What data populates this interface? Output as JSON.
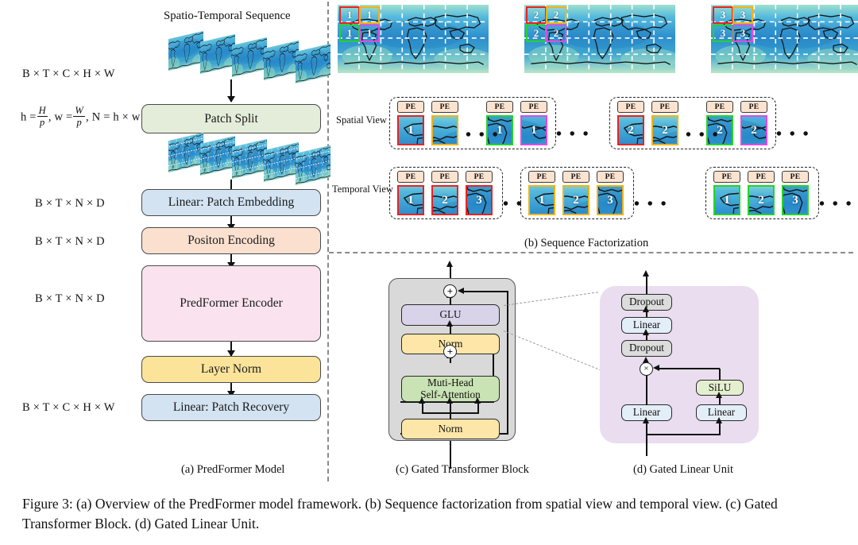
{
  "figure": {
    "caption": "Figure 3: (a) Overview of the PredFormer model framework. (b) Sequence factorization from spatial view and temporal view. (c) Gated Transformer Block. (d) Gated Linear Unit."
  },
  "panel_a": {
    "caption": "(a) PredFormer Model",
    "sequence_title": "Spatio-Temporal Sequence",
    "shapes": [
      "B × T × C × H × W",
      "B × T × N × D",
      "B × T × N × D",
      "B × T × N × D",
      "B × T × C × H × W"
    ],
    "patch_formula": {
      "prefix_h": "h =",
      "h_num": "H",
      "h_den": "p",
      "mid_w": ", w =",
      "w_num": "W",
      "w_den": "p",
      "suffix": ", N = h × w"
    },
    "blocks": [
      {
        "label": "Patch Split",
        "color": "#e4edd9"
      },
      {
        "label": "Linear: Patch Embedding",
        "color": "#d3e3f2"
      },
      {
        "label": "Positon Encoding",
        "color": "#fbe0d0"
      },
      {
        "label": "PredFormer Encoder",
        "color": "#fae3ee"
      },
      {
        "label": "Layer Norm",
        "color": "#fbe49a"
      },
      {
        "label": "Linear: Patch Recovery",
        "color": "#d3e3f2"
      }
    ]
  },
  "panel_b": {
    "caption": "(b) Sequence Factorization",
    "view_labels": {
      "spatial": "Spatial View",
      "temporal": "Temporal View"
    },
    "pe_label": "PE",
    "ellipsis": "• • •",
    "patch_colors": {
      "red": "#ef2020",
      "orange": "#f5b115",
      "green": "#25d32b",
      "magenta": "#e24ae2"
    },
    "frames": [
      {
        "index": "1",
        "patch_labels": [
          "1",
          "1",
          "1",
          "1"
        ]
      },
      {
        "index": "2",
        "patch_labels": [
          "2",
          "2",
          "2",
          "2"
        ]
      },
      {
        "index": "3",
        "patch_labels": [
          "3",
          "3",
          "3",
          "3"
        ]
      }
    ],
    "spatial_groups": [
      {
        "tokens": [
          {
            "label": "1",
            "border": "red"
          },
          {
            "label": "",
            "border": "orange"
          },
          {
            "label": "1",
            "border": "green"
          },
          {
            "label": "1",
            "border": "magenta"
          }
        ]
      },
      {
        "tokens": [
          {
            "label": "2",
            "border": "red"
          },
          {
            "label": "2",
            "border": "orange"
          },
          {
            "label": "2",
            "border": "green"
          },
          {
            "label": "2",
            "border": "magenta"
          }
        ]
      }
    ],
    "temporal_groups": [
      {
        "tokens": [
          {
            "label": "1",
            "border": "red"
          },
          {
            "label": "2",
            "border": "red"
          },
          {
            "label": "3",
            "border": "red"
          }
        ]
      },
      {
        "tokens": [
          {
            "label": "1",
            "border": "orange"
          },
          {
            "label": "2",
            "border": "orange"
          },
          {
            "label": "3",
            "border": "orange"
          }
        ]
      },
      {
        "tokens": [
          {
            "label": "1",
            "border": "green"
          },
          {
            "label": "2",
            "border": "green"
          },
          {
            "label": "3",
            "border": "green"
          }
        ]
      }
    ]
  },
  "panel_c": {
    "caption": "(c) Gated Transformer Block",
    "plus_symbol": "+",
    "blocks": [
      {
        "label": "GLU",
        "color": "#d8d3e8"
      },
      {
        "label": "Norm",
        "color": "#fde6a8"
      },
      {
        "label": "Muti-Head\nSelf-Attention",
        "color": "#c9e3b4"
      },
      {
        "label": "Norm",
        "color": "#fde6a8"
      }
    ]
  },
  "panel_d": {
    "caption": "(d) Gated Linear Unit",
    "times_symbol": "×",
    "blocks": [
      {
        "label": "Dropout",
        "color": "#dcdcdc"
      },
      {
        "label": "Linear",
        "color": "#e3eef8"
      },
      {
        "label": "Dropout",
        "color": "#dcdcdc"
      },
      {
        "label": "SiLU",
        "color": "#e4efcf"
      },
      {
        "label": "Linear",
        "color": "#e3eef8"
      },
      {
        "label": "Linear",
        "color": "#e3eef8"
      }
    ]
  }
}
